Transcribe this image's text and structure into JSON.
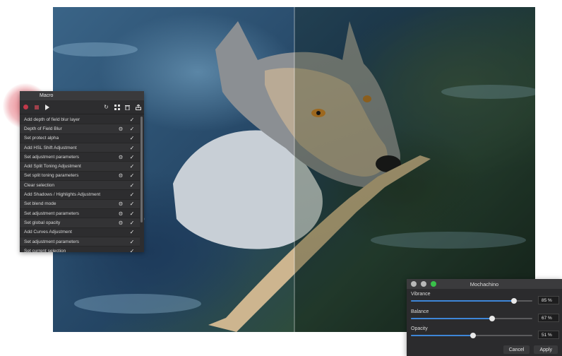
{
  "macro_panel": {
    "title": "Macro",
    "toolbar": {
      "record_icon": "record-icon",
      "stop_icon": "stop-icon",
      "play_icon": "play-icon",
      "reset_icon": "reset-icon",
      "library_icon": "library-icon",
      "trash_icon": "trash-icon",
      "export_icon": "export-icon"
    },
    "steps": [
      {
        "label": "Add depth of field blur layer",
        "gear": false
      },
      {
        "label": "Depth of Field Blur",
        "gear": true
      },
      {
        "label": "Set protect alpha",
        "gear": false
      },
      {
        "label": "Add HSL Shift Adjustment",
        "gear": false
      },
      {
        "label": "Set adjustment parameters",
        "gear": true
      },
      {
        "label": "Add Split Toning Adjustment",
        "gear": false
      },
      {
        "label": "Set split toning parameters",
        "gear": true
      },
      {
        "label": "Clear selection",
        "gear": false
      },
      {
        "label": "Add Shadows / Highlights Adjustment",
        "gear": false
      },
      {
        "label": "Set blend mode",
        "gear": true
      },
      {
        "label": "Set adjustment parameters",
        "gear": true
      },
      {
        "label": "Set global opacity",
        "gear": true
      },
      {
        "label": "Add Curves Adjustment",
        "gear": false
      },
      {
        "label": "Set adjustment parameters",
        "gear": false
      },
      {
        "label": "Set current selection",
        "gear": false
      }
    ]
  },
  "mocha_panel": {
    "title": "Mochachino",
    "params": [
      {
        "name": "Vibrance",
        "value": "85 %",
        "level": 0.85
      },
      {
        "name": "Balance",
        "value": "67 %",
        "level": 0.67
      },
      {
        "name": "Opacity",
        "value": "51 %",
        "level": 0.51
      }
    ],
    "cancel_label": "Cancel",
    "apply_label": "Apply"
  },
  "colors": {
    "panel_bg": "#2d2d2f",
    "accent_blue": "#3e86d8",
    "record_red": "#c0394a",
    "traffic_green": "#39c14a"
  }
}
